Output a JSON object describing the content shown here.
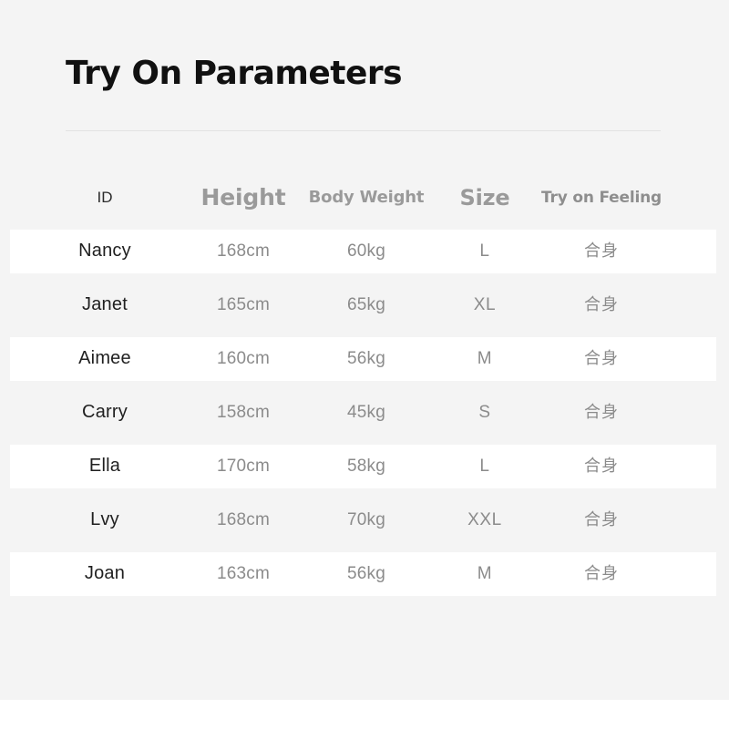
{
  "page": {
    "title": "Try On Parameters",
    "background_color": "#f4f4f4",
    "panel_bottom_color": "#ffffff",
    "row_highlight_color": "#ffffff",
    "divider_color": "#e2e2e2"
  },
  "table": {
    "columns": [
      {
        "key": "id",
        "label": "ID"
      },
      {
        "key": "height",
        "label": "Height"
      },
      {
        "key": "body_weight",
        "label": "Body Weight"
      },
      {
        "key": "size",
        "label": "Size"
      },
      {
        "key": "try_on_feeling",
        "label": "Try on Feeling"
      }
    ],
    "rows": [
      {
        "id": "Nancy",
        "height": "168cm",
        "body_weight": "60kg",
        "size": "L",
        "try_on_feeling": "合身"
      },
      {
        "id": "Janet",
        "height": "165cm",
        "body_weight": "65kg",
        "size": "XL",
        "try_on_feeling": "合身"
      },
      {
        "id": "Aimee",
        "height": "160cm",
        "body_weight": "56kg",
        "size": "M",
        "try_on_feeling": "合身"
      },
      {
        "id": "Carry",
        "height": "158cm",
        "body_weight": "45kg",
        "size": "S",
        "try_on_feeling": "合身"
      },
      {
        "id": "Ella",
        "height": "170cm",
        "body_weight": "58kg",
        "size": "L",
        "try_on_feeling": "合身"
      },
      {
        "id": "Lvy",
        "height": "168cm",
        "body_weight": "70kg",
        "size": "XXL",
        "try_on_feeling": "合身"
      },
      {
        "id": "Joan",
        "height": "163cm",
        "body_weight": "56kg",
        "size": "M",
        "try_on_feeling": "合身"
      }
    ]
  }
}
